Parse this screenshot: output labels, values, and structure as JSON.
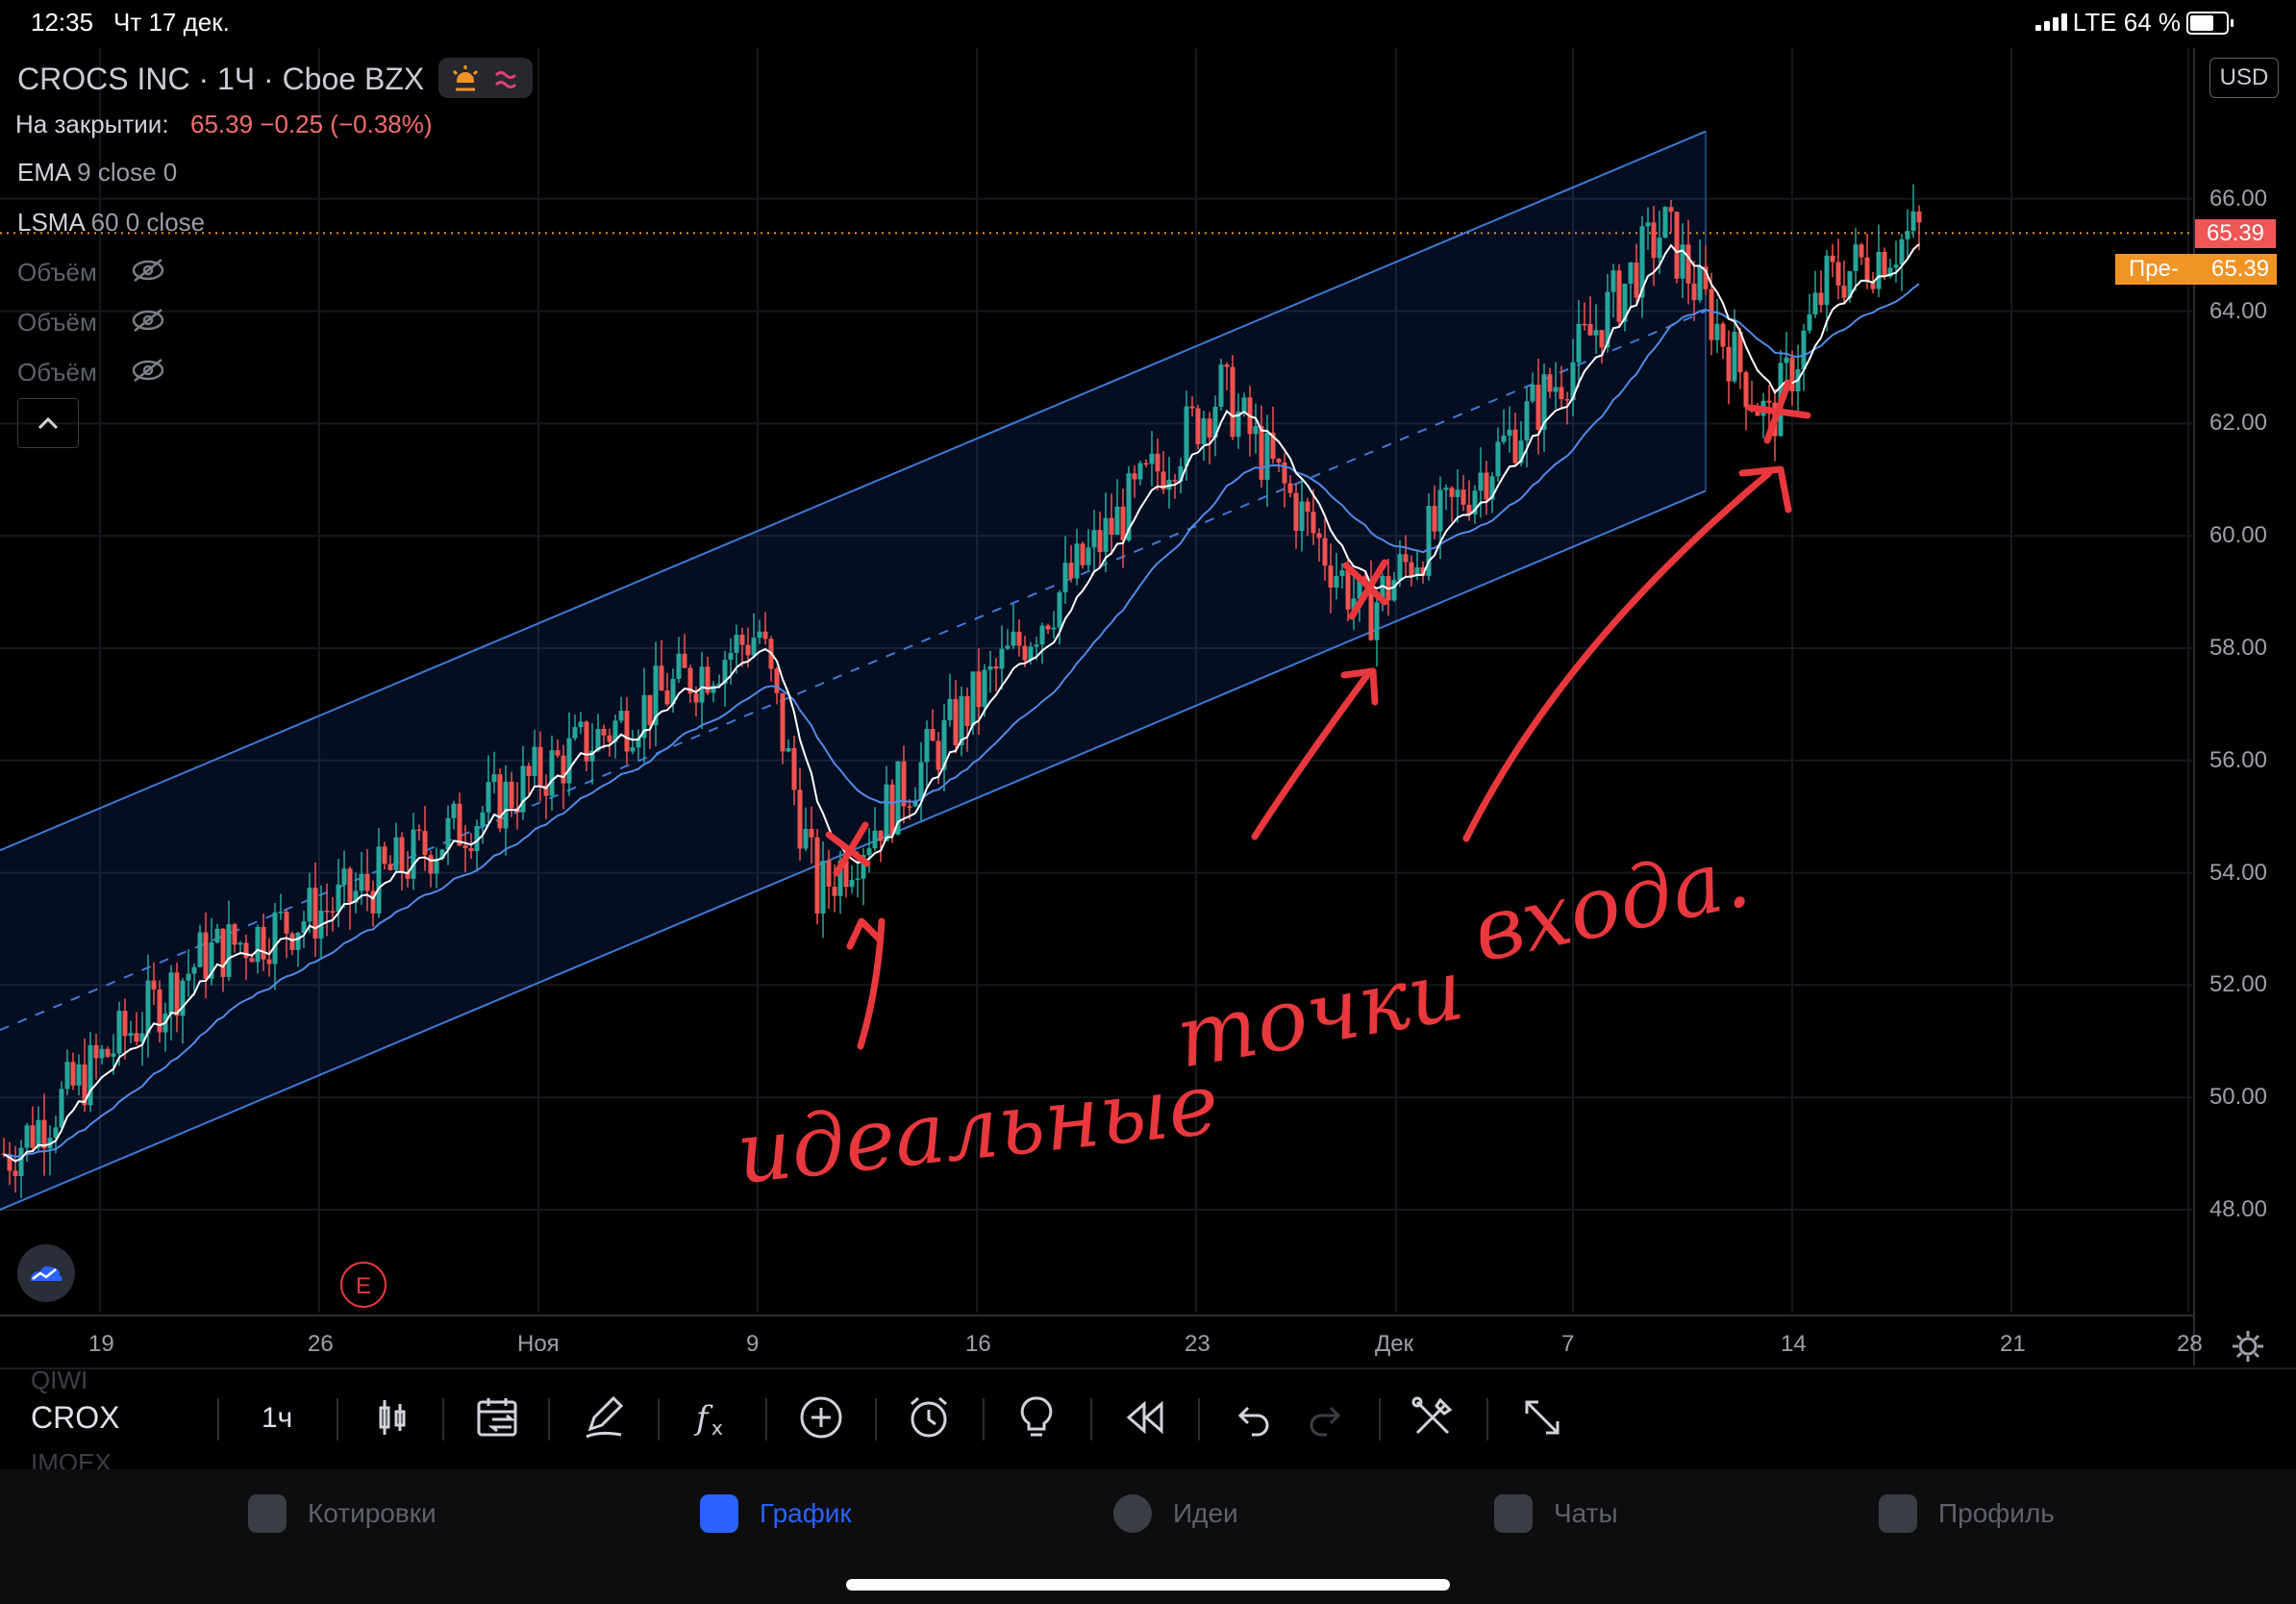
{
  "status_bar": {
    "time": "12:35",
    "date": "Чт 17 дек.",
    "network": "LTE 64 %"
  },
  "legend": {
    "symbol": "CROCS INC · 1Ч · Cboe BZX",
    "close_label": "На закрытии:",
    "close_value": "65.39  −0.25 (−0.38%)",
    "ema_name": "EMA",
    "ema_params": "9 close 0",
    "lsma_name": "LSMA",
    "lsma_params": "60 0 close",
    "volume_items": [
      "Объём",
      "Объём",
      "Объём"
    ]
  },
  "currency": "USD",
  "price_axis": {
    "labels": [
      "66.00",
      "64.00",
      "62.00",
      "60.00",
      "58.00",
      "56.00",
      "54.00",
      "52.00",
      "50.00",
      "48.00"
    ],
    "last_price": "65.39",
    "pre_label": "Пре-",
    "pre_price": "65.39"
  },
  "time_axis": [
    "19",
    "26",
    "Ноя",
    "9",
    "16",
    "23",
    "Дек",
    "7",
    "14",
    "21",
    "28"
  ],
  "earnings_marker": "E",
  "annotation": {
    "word1": "идеальные",
    "word2": "точки",
    "word3": "входа."
  },
  "toolbar": {
    "ticker_prev": "QIWI",
    "ticker": "CROX",
    "ticker_next": "IMOEX",
    "interval": "1ч"
  },
  "nav": {
    "quotes": "Котировки",
    "chart": "График",
    "ideas": "Идеи",
    "chats": "Чаты",
    "profile": "Профиль"
  },
  "colors": {
    "background": "#000000",
    "up": "#26a69a",
    "down": "#ef5350",
    "channel": "#3d7ad6",
    "annotation": "#e8383d",
    "accent": "#2962ff",
    "pre_market": "#f19426"
  },
  "chart_data": {
    "type": "candlestick",
    "x_ticks": [
      "19",
      "26",
      "Ноя",
      "9",
      "16",
      "23",
      "Дек",
      "7",
      "14",
      "21",
      "28"
    ],
    "ylim": [
      46.5,
      67.5
    ],
    "y_ticks": [
      48,
      50,
      52,
      54,
      56,
      58,
      60,
      62,
      64,
      66
    ],
    "last": 65.39,
    "key_points": [
      {
        "label": "19",
        "price": 49.0
      },
      {
        "label": "26",
        "price": 52.5
      },
      {
        "label": "Ноя",
        "price": 53.5
      },
      {
        "label": "9",
        "price": 58.3
      },
      {
        "label": "9",
        "price": 53.6
      },
      {
        "label": "16",
        "price": 57.0
      },
      {
        "label": "23",
        "price": 62.6
      },
      {
        "label": "Дек",
        "price": 58.6
      },
      {
        "label": "7",
        "price": 63.2
      },
      {
        "label": "7",
        "price": 65.5
      },
      {
        "label": "14",
        "price": 62.0
      },
      {
        "label": "14",
        "price": 64.5
      },
      {
        "label": "21",
        "price": 65.4
      }
    ],
    "series": [
      {
        "name": "EMA",
        "values": []
      },
      {
        "name": "LSMA",
        "values": []
      }
    ],
    "channel": {
      "type": "regression-channel",
      "start_mid": 51.2,
      "end_mid": 64.0
    }
  }
}
